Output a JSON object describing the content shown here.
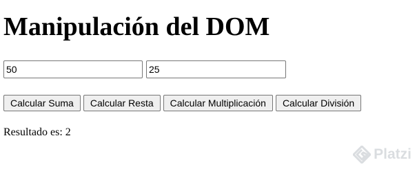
{
  "heading": "Manipulación del DOM",
  "inputs": {
    "first_value": "50",
    "second_value": "25"
  },
  "buttons": {
    "sum": "Calcular Suma",
    "subtract": "Calcular Resta",
    "multiply": "Calcular Multiplicación",
    "divide": "Calcular División"
  },
  "result": "Resultado es: 2",
  "watermark": {
    "text": "Platzi",
    "icon": "platzi-logo-icon"
  }
}
